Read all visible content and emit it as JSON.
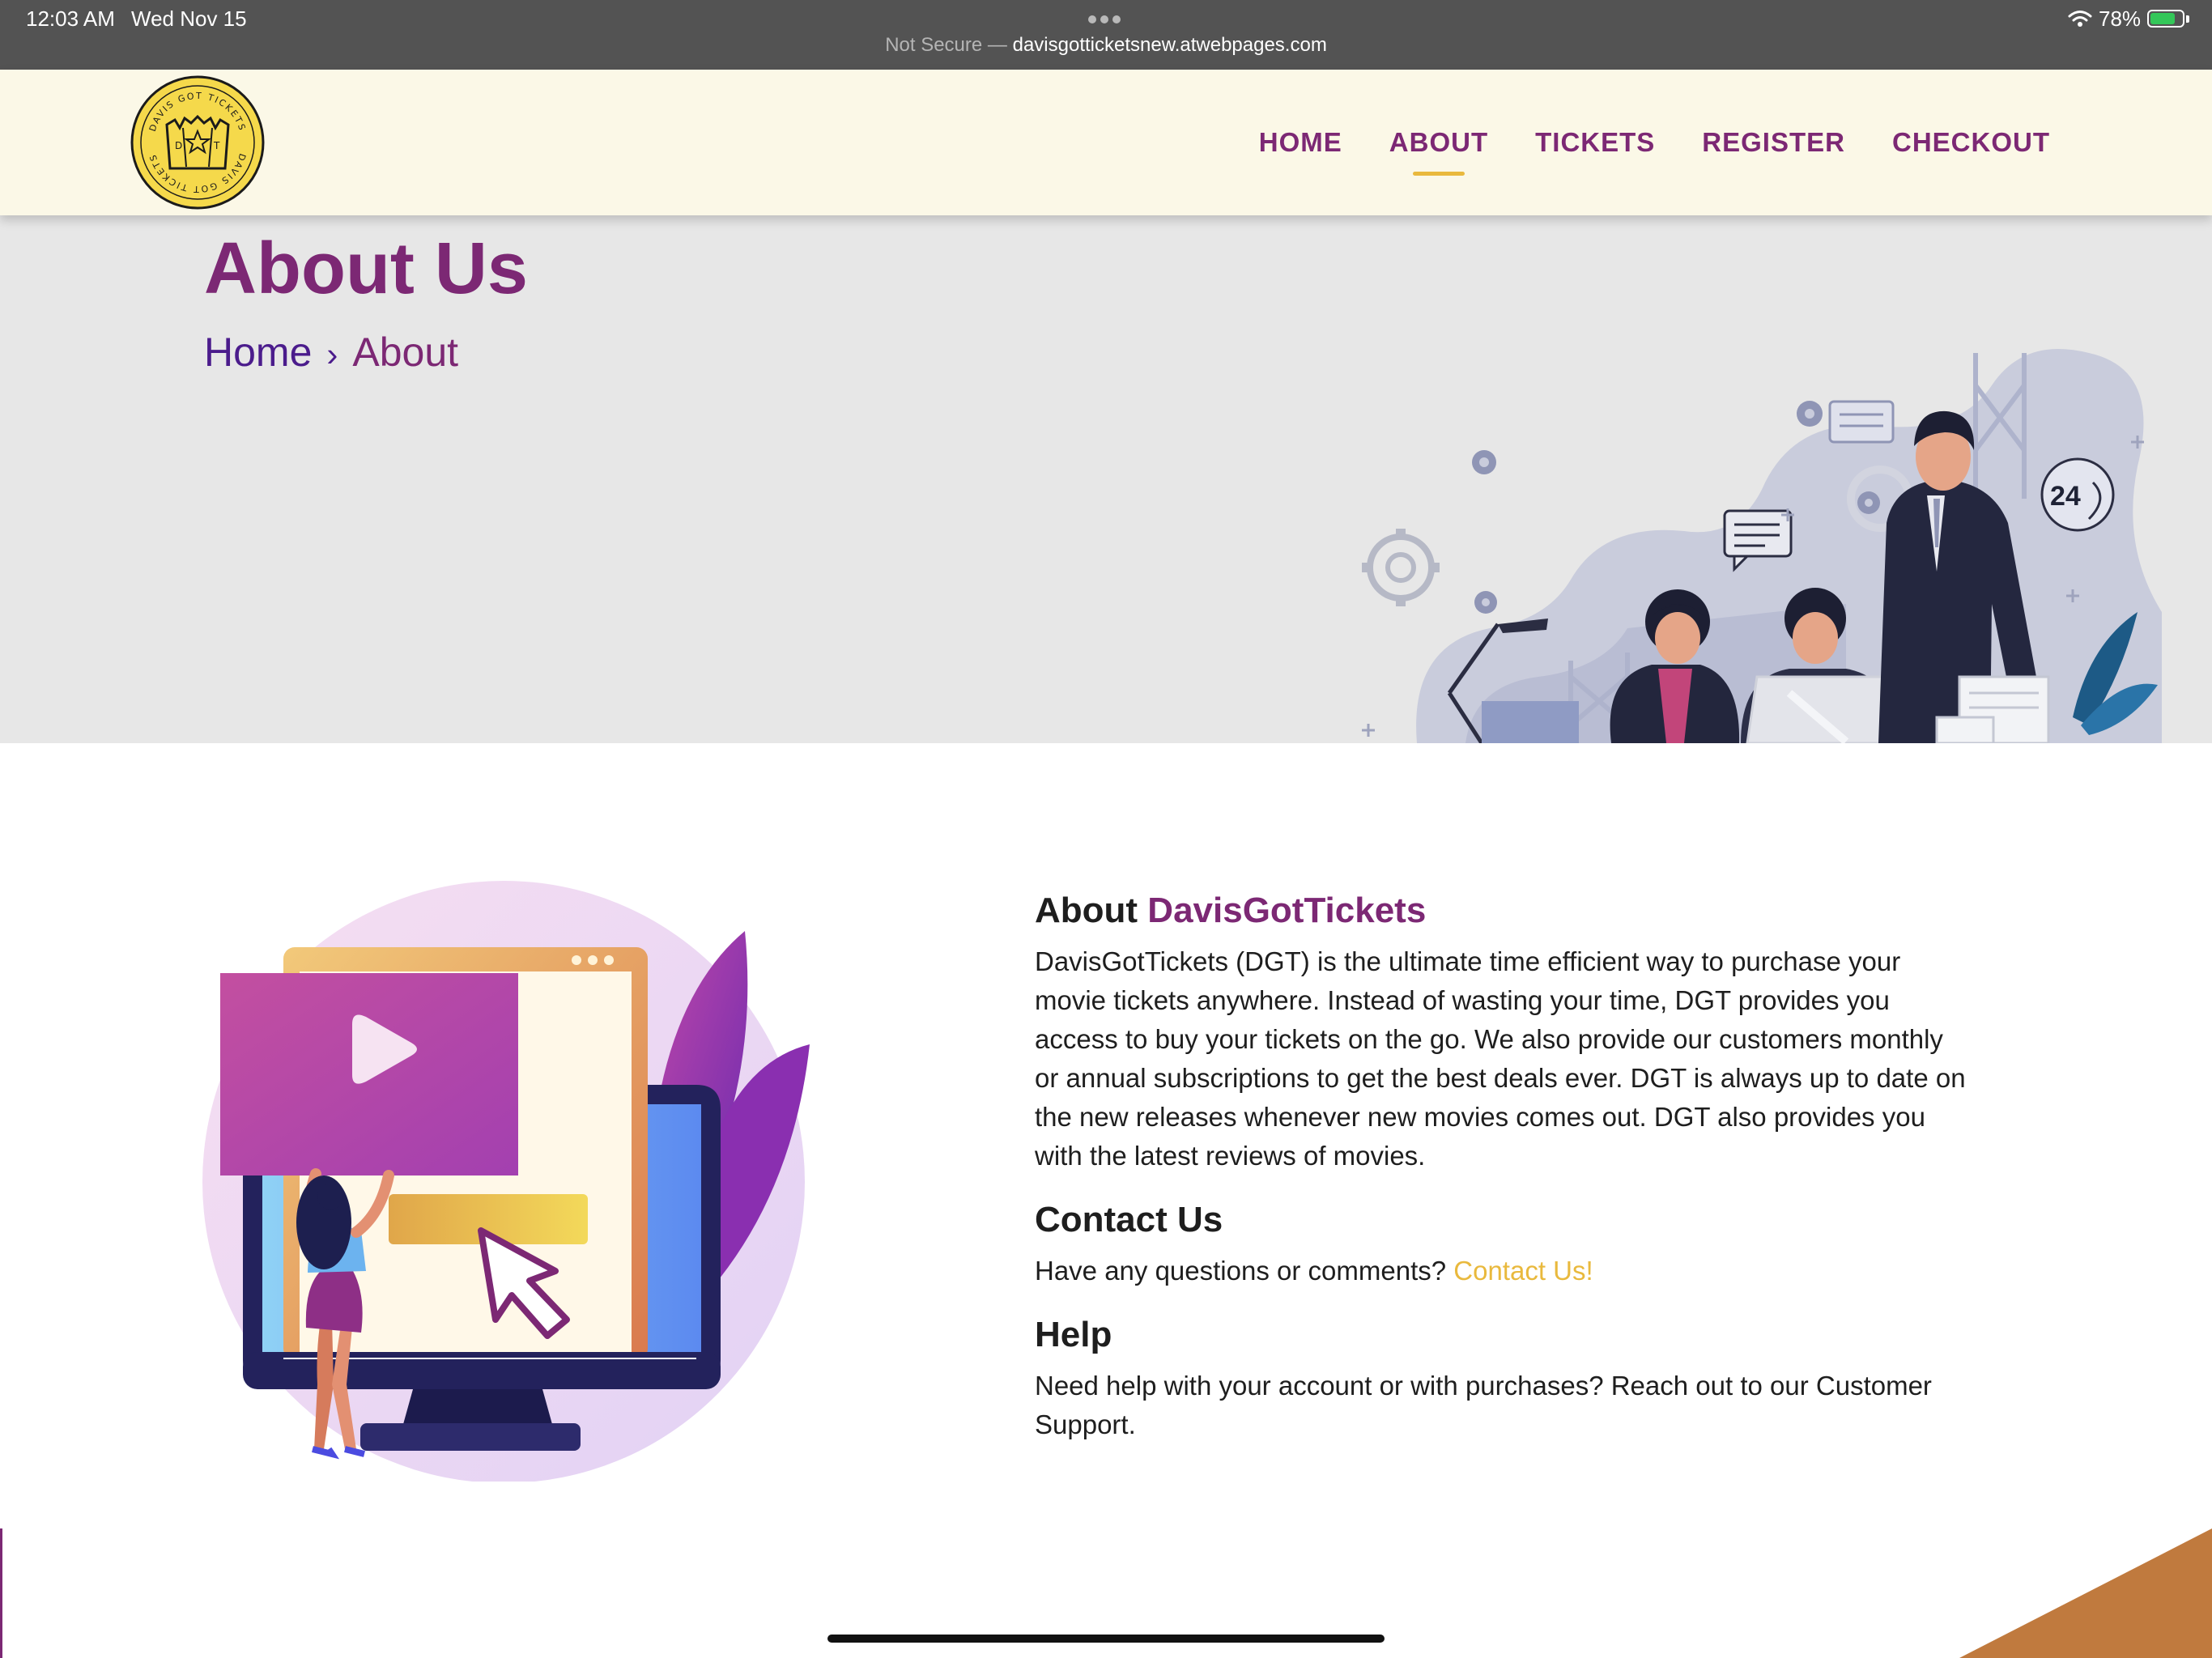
{
  "status_bar": {
    "time": "12:03 AM",
    "date": "Wed Nov 15",
    "battery_percent": "78%",
    "battery_level": 0.78,
    "url_prefix": "Not Secure — ",
    "url_host": "davisgotticketsnew.atwebpages.com"
  },
  "logo": {
    "top_text": "DAVIS GOT TICKETS",
    "bottom_text": "DAVIS GOT TICKETS",
    "left_letter": "D",
    "right_letter": "T"
  },
  "nav": {
    "items": [
      {
        "label": "HOME"
      },
      {
        "label": "ABOUT"
      },
      {
        "label": "TICKETS"
      },
      {
        "label": "REGISTER"
      },
      {
        "label": "CHECKOUT"
      }
    ],
    "active": "ABOUT"
  },
  "hero": {
    "title": "About Us",
    "breadcrumb": {
      "home": "Home",
      "separator": "›",
      "current": "About"
    },
    "badge_24": "24"
  },
  "about": {
    "heading_prefix": "About ",
    "heading_brand": "DavisGotTickets",
    "body": "DavisGotTickets (DGT) is the ultimate time efficient way to purchase your movie tickets anywhere. Instead of wasting your time, DGT provides you access to buy your tickets on the go. We also provide our customers monthly or annual subscriptions to get the best deals ever. DGT is always up to date on the new releases whenever new movies comes out. DGT also provides you with the latest reviews of movies."
  },
  "contact": {
    "heading": "Contact Us",
    "text": "Have any questions or comments? ",
    "link": "Contact Us!"
  },
  "help": {
    "heading": "Help",
    "text": "Need help with your account or with purchases? Reach out to our Customer Support."
  },
  "colors": {
    "brand_purple": "#7c2874",
    "accent_gold": "#e9b93d",
    "header_bg": "#fbf8e7",
    "hero_bg": "#e7e7e7",
    "corner_orange": "#c07a3e"
  },
  "icons": [
    "wifi-icon",
    "battery-icon",
    "logo-ticket-icon",
    "play-icon",
    "cursor-arrow-icon",
    "gear-icon",
    "chat-bubble-icon",
    "phone-24-icon"
  ]
}
